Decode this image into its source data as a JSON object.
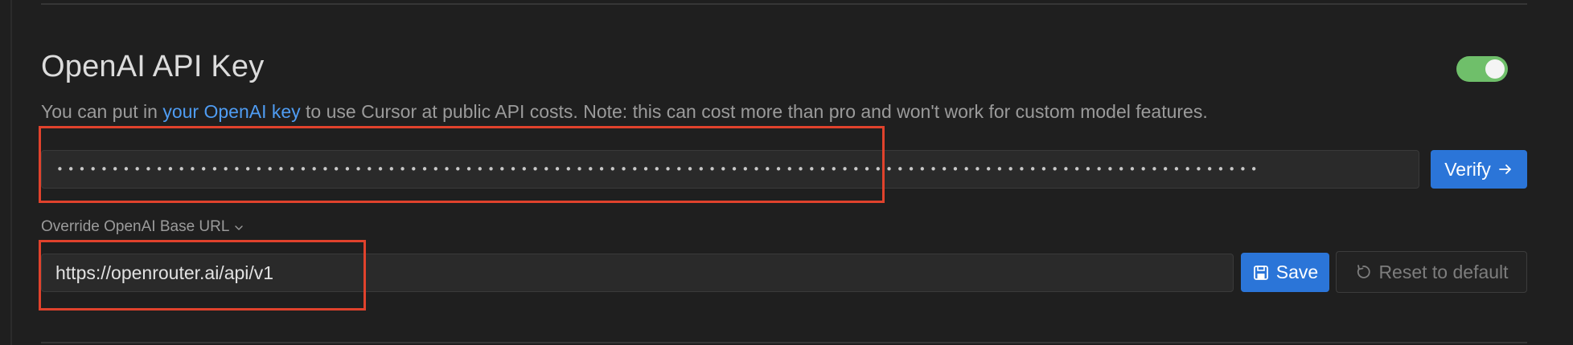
{
  "section": {
    "title": "OpenAI API Key",
    "toggle": {
      "enabled": true,
      "color": "#6fbf6a"
    },
    "description": {
      "prefix": "You can put in ",
      "link_text": "your OpenAI key",
      "suffix": " to use Cursor at public API costs. Note: this can cost more than pro and won't work for custom model features."
    },
    "api_key_field": {
      "value": "•••••••••••••••••••••••••••••••••••••••••••••••••••••••••••••••••••••••••••••••••••••••••••••••••••••••••••••"
    },
    "verify_button": {
      "label": "Verify",
      "icon": "arrow-right-icon"
    },
    "override": {
      "label": "Override OpenAI Base URL",
      "icon": "chevron-down-icon"
    },
    "base_url_field": {
      "value": "https://openrouter.ai/api/v1"
    },
    "save_button": {
      "label": "Save",
      "icon": "save-icon"
    },
    "reset_button": {
      "label": "Reset to default",
      "icon": "refresh-icon"
    }
  },
  "colors": {
    "background": "#1f1f1f",
    "link": "#4f9cf2",
    "primary_button": "#2b75d8",
    "annotation": "#e0422c"
  }
}
